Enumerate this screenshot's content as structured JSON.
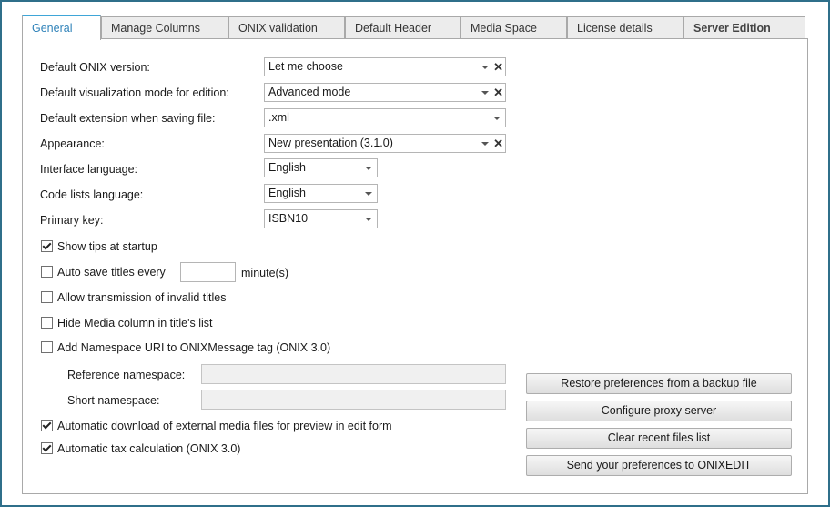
{
  "tabs": [
    "General",
    "Manage Columns",
    "ONIX validation",
    "Default Header",
    "Media Space",
    "License details",
    "Server Edition"
  ],
  "fields": {
    "onix_version": {
      "label": "Default ONIX version:",
      "value": "Let me choose"
    },
    "visualization_mode": {
      "label": "Default visualization mode for edition:",
      "value": "Advanced mode"
    },
    "extension": {
      "label": "Default extension when saving file:",
      "value": ".xml"
    },
    "appearance": {
      "label": "Appearance:",
      "value": "New presentation (3.1.0)"
    },
    "interface_language": {
      "label": "Interface language:",
      "value": "English"
    },
    "code_lists_language": {
      "label": "Code lists language:",
      "value": "English"
    },
    "primary_key": {
      "label": "Primary key:",
      "value": "ISBN10"
    }
  },
  "checks": {
    "show_tips": {
      "label": "Show tips at startup",
      "checked": true
    },
    "auto_save": {
      "label": "Auto save titles every",
      "checked": false,
      "value": "",
      "unit": "minute(s)"
    },
    "invalid_titles": {
      "label": "Allow transmission of invalid titles",
      "checked": false
    },
    "hide_media": {
      "label": "Hide Media column in title's list",
      "checked": false
    },
    "namespace_uri": {
      "label": "Add Namespace URI to ONIXMessage tag (ONIX 3.0)",
      "checked": false
    },
    "auto_download": {
      "label": "Automatic download of external media files for preview in edit form",
      "checked": true
    },
    "auto_tax": {
      "label": "Automatic tax calculation (ONIX 3.0)",
      "checked": true
    }
  },
  "namespace": {
    "reference_label": "Reference namespace:",
    "reference_value": "",
    "short_label": "Short namespace:",
    "short_value": ""
  },
  "buttons": {
    "restore": "Restore preferences from a backup file",
    "proxy": "Configure proxy server",
    "clear_recent": "Clear recent files list",
    "send_prefs": "Send your preferences to ONIXEDIT"
  },
  "colors": {
    "frame": "#2f6f8a",
    "active_tab_text": "#2f82b9",
    "active_tab_accent": "#3fa6d8"
  }
}
